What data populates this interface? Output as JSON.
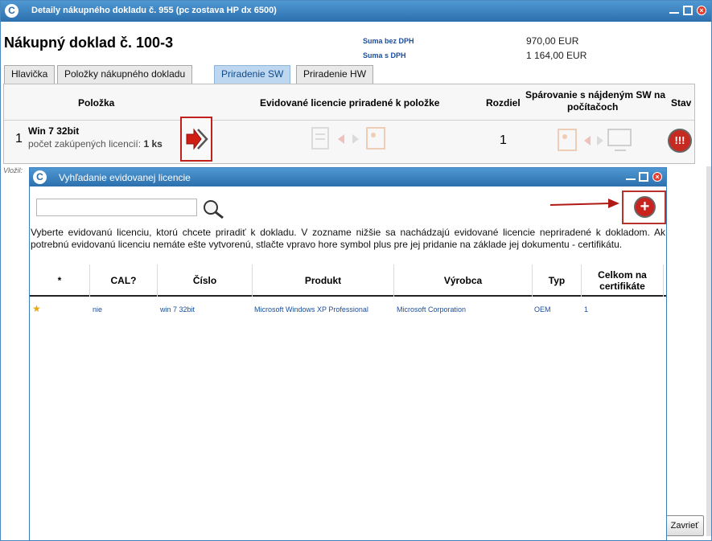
{
  "window": {
    "app_icon": "C",
    "title": "Detaily nákupného dokladu č. 955 (pc zostava HP dx 6500)",
    "document_title": "Nákupný doklad č. 100-3",
    "summary": [
      {
        "label": "Suma bez DPH",
        "value": "970,00 EUR"
      },
      {
        "label": "Suma s DPH",
        "value": "1 164,00 EUR"
      }
    ],
    "tabs": [
      {
        "label": "Hlavička",
        "active": false
      },
      {
        "label": "Položky nákupného dokladu",
        "active": false
      },
      {
        "label": "Priradenie SW",
        "active": true
      },
      {
        "label": "Priradenie HW",
        "active": false
      }
    ],
    "table": {
      "headers": {
        "item": "Položka",
        "licenses": "Evidované licencie priradené k položke",
        "difference": "Rozdiel",
        "pairing_line1": "Spárovanie s nájdeným SW na",
        "pairing_line2": "počítačoch",
        "status": "Stav"
      },
      "row": {
        "number": "1",
        "name": "Win 7 32bit",
        "sub_label": "počet zakúpených licencií:",
        "sub_value": "1 ks",
        "difference": "1",
        "status_symbol": "!!!"
      }
    },
    "footer_hint": "Vložil:",
    "close_button": "Zavrieť"
  },
  "dialog": {
    "app_icon": "C",
    "title": "Vyhľadanie evidovanej licencie",
    "search": {
      "value": "",
      "placeholder": ""
    },
    "add_button": "+",
    "info": "Vyberte evidovanú licenciu, ktorú chcete priradiť k dokladu. V zozname nižšie sa nachádzajú evidované licencie nepriradené k dokladom. Ak potrebnú evidovanú licenciu nemáte ešte vytvorenú, stlačte vpravo hore symbol plus pre jej pridanie na základe jej dokumentu - certifikátu.",
    "columns": {
      "star": "*",
      "cal": "CAL?",
      "number": "Číslo",
      "product": "Produkt",
      "vendor": "Výrobca",
      "type": "Typ",
      "total_line1": "Celkom na",
      "total_line2": "certifikáte"
    },
    "rows": [
      {
        "star": "★",
        "cal": "nie",
        "number": "win 7 32bit",
        "product": "Microsoft Windows XP Professional",
        "vendor": "Microsoft Corporation",
        "type": "OEM",
        "total": "1"
      }
    ]
  },
  "colors": {
    "titlebar": "#2c70ad",
    "accent_red": "#c9231e",
    "link_blue": "#1a4d9c",
    "active_tab": "#bcd7ef"
  },
  "icons": [
    "app-logo-icon",
    "minimize-icon",
    "maximize-icon",
    "close-icon",
    "assign-arrow-icon",
    "status-alert-icon",
    "search-icon",
    "plus-icon",
    "red-arrow-icon",
    "star-icon"
  ]
}
